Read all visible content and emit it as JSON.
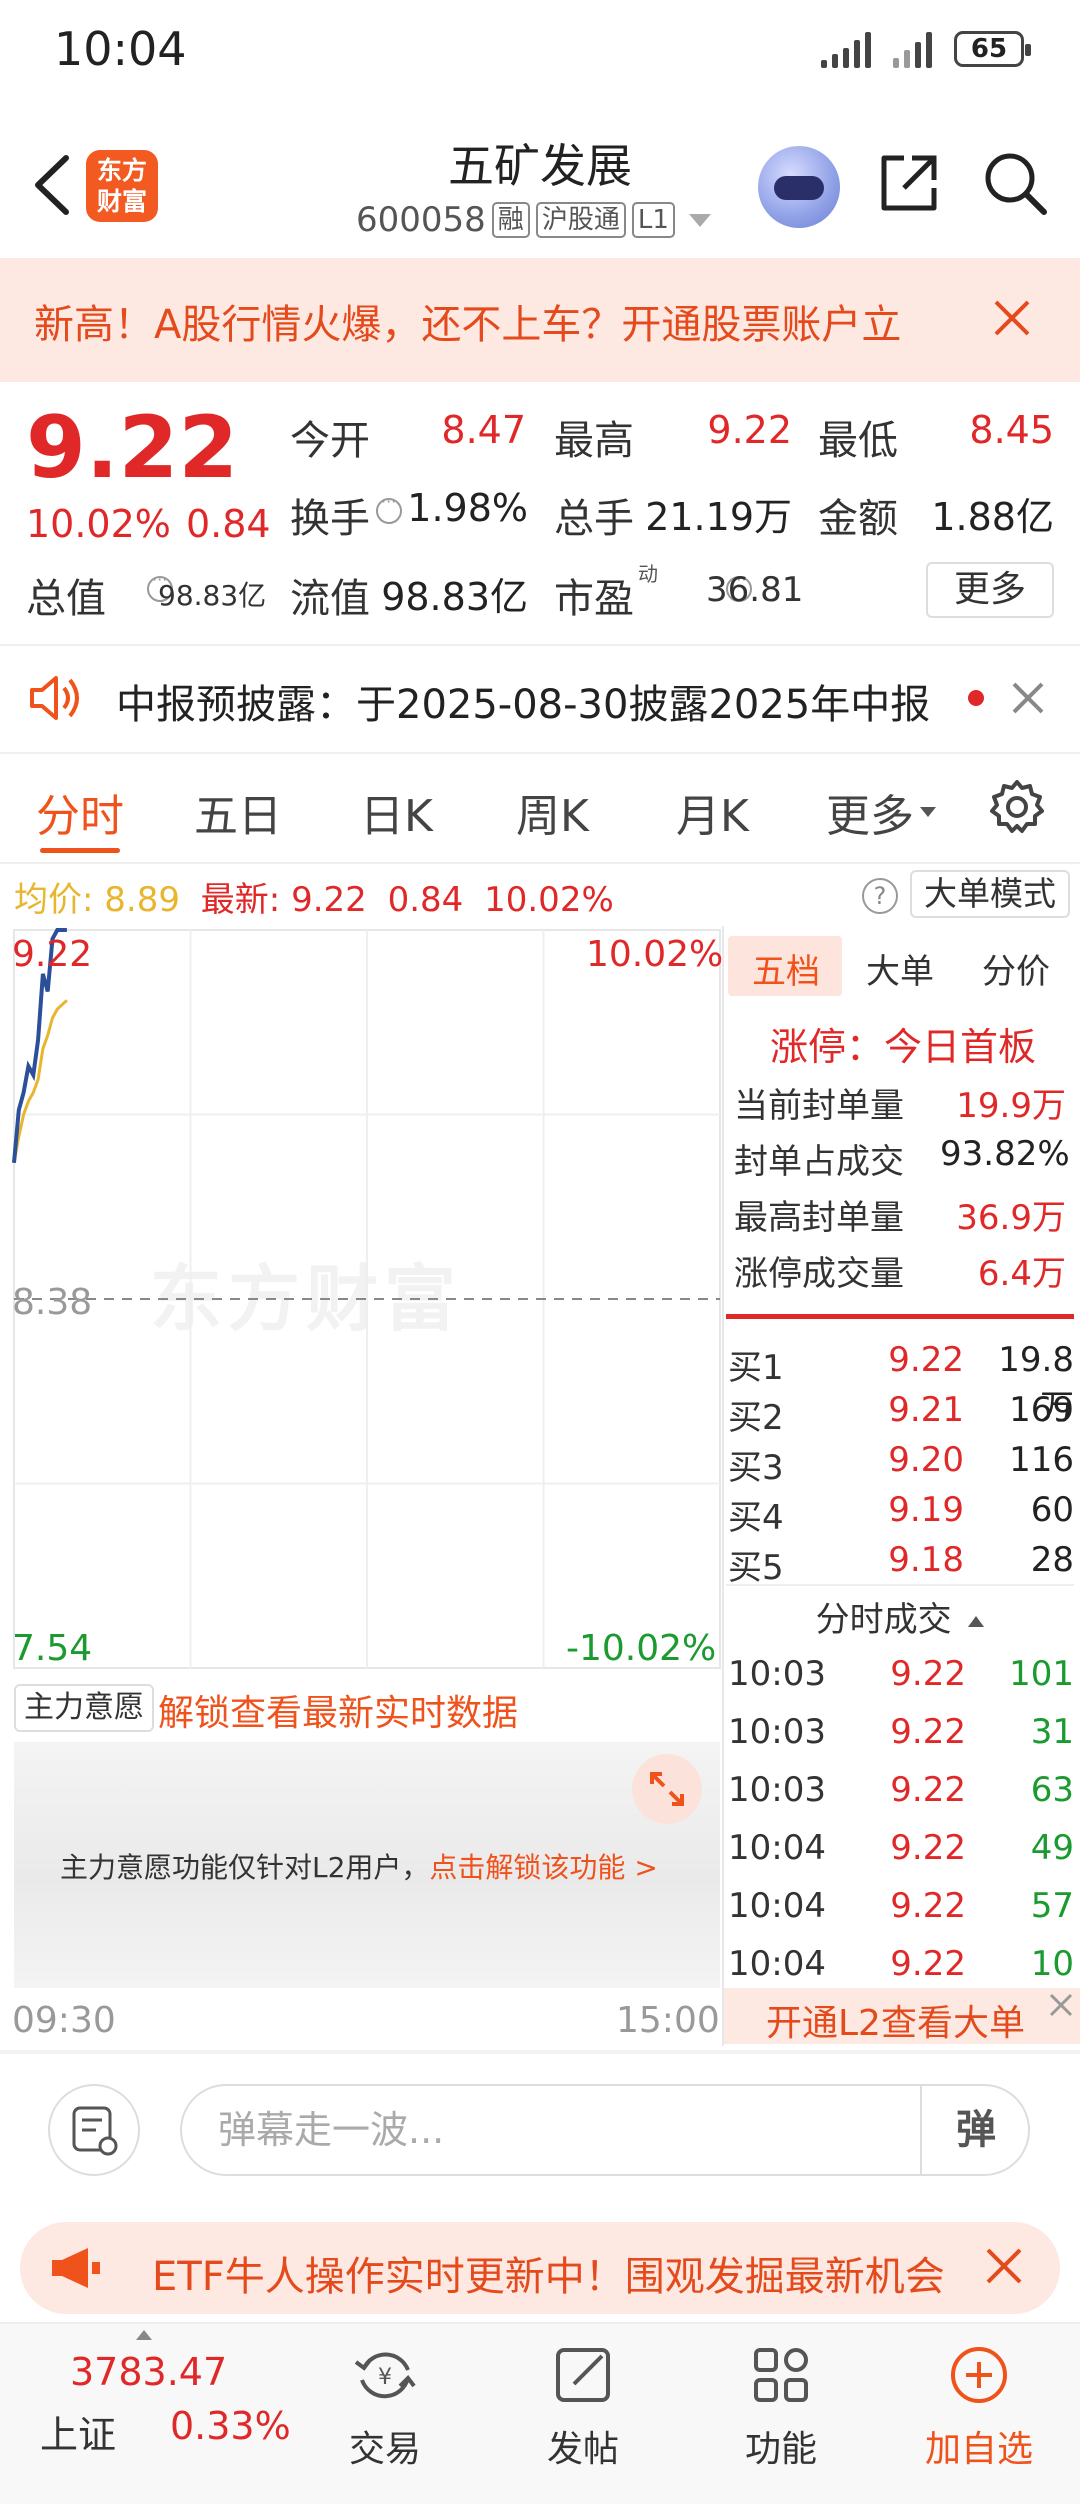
{
  "status_bar": {
    "time": "10:04",
    "battery": "65"
  },
  "header": {
    "logo_text": "东方财富",
    "stock_name": "五矿发展",
    "stock_code": "600058",
    "tags": [
      "融",
      "沪股通",
      "L1"
    ]
  },
  "promo": {
    "text": "新高！A股行情火爆，还不上车？开通股票账户立"
  },
  "quote": {
    "price": "9.22",
    "change_pct": "10.02%",
    "change": "0.84",
    "fields": {
      "open_label": "今开",
      "open": "8.47",
      "high_label": "最高",
      "high": "9.22",
      "low_label": "最低",
      "low": "8.45",
      "turnover_label": "换手",
      "turnover": "1.98%",
      "volume_label": "总手",
      "volume": "21.19万",
      "amount_label": "金额",
      "amount": "1.88亿",
      "mktcap_label": "总值",
      "mktcap": "98.83亿",
      "float_label": "流值",
      "float": "98.83亿",
      "pe_label": "市盈",
      "pe_sup": "动",
      "pe": "36.81"
    },
    "more_label": "更多"
  },
  "notice": {
    "text": "中报预披露：于2025-08-30披露2025年中报"
  },
  "tabs": [
    "分时",
    "五日",
    "日K",
    "周K",
    "月K",
    "更多"
  ],
  "avg_row": {
    "avg_label": "均价:",
    "avg": "8.89",
    "latest_label": "最新:",
    "latest": "9.22",
    "change": "0.84",
    "pct": "10.02%",
    "help": "?",
    "bigorder_label": "大单模式"
  },
  "chart": {
    "hi_price": "9.22",
    "hi_pct": "10.02%",
    "mid_price": "8.38",
    "lo_price": "7.54",
    "lo_pct": "-10.02%",
    "watermark": "东方财富",
    "time_start": "09:30",
    "time_end": "15:00"
  },
  "chart_data": {
    "type": "line",
    "ylim": [
      7.54,
      9.22
    ],
    "prev_close": 8.38,
    "x_range": [
      "09:30",
      "15:00"
    ],
    "series": [
      {
        "values": [
          8.69,
          8.81,
          8.85,
          8.91,
          8.89,
          8.97,
          9.12,
          9.08,
          9.2,
          9.22,
          9.22,
          9.22
        ]
      },
      {
        "values": [
          8.69,
          8.75,
          8.8,
          8.83,
          8.85,
          8.88,
          8.95,
          8.98,
          9.02,
          9.04,
          9.05,
          9.06
        ]
      }
    ],
    "colors": {
      "price": "#2c4f9a",
      "avg": "#e8b52e"
    }
  },
  "main_force": {
    "select_label": "主力意愿",
    "unlock_text": "解锁查看最新实时数据",
    "panel_text": "主力意愿功能仅针对L2用户，",
    "panel_link": "点击解锁该功能 >"
  },
  "right_panel": {
    "tabs": [
      "五档",
      "大单",
      "分价"
    ],
    "limit_text": "涨停：今日首板",
    "stats": [
      {
        "label": "当前封单量",
        "value": "19.9万"
      },
      {
        "label": "封单占成交",
        "value": "93.82%"
      },
      {
        "label": "最高封单量",
        "value": "36.9万"
      },
      {
        "label": "涨停成交量",
        "value": "6.4万"
      }
    ],
    "bids": [
      {
        "label": "买1",
        "price": "9.22",
        "vol": "19.8万"
      },
      {
        "label": "买2",
        "price": "9.21",
        "vol": "169"
      },
      {
        "label": "买3",
        "price": "9.20",
        "vol": "116"
      },
      {
        "label": "买4",
        "price": "9.19",
        "vol": "60"
      },
      {
        "label": "买5",
        "price": "9.18",
        "vol": "28"
      }
    ],
    "ticks_title": "分时成交",
    "ticks": [
      {
        "time": "10:03",
        "price": "9.22",
        "vol": "101"
      },
      {
        "time": "10:03",
        "price": "9.22",
        "vol": "31"
      },
      {
        "time": "10:03",
        "price": "9.22",
        "vol": "63"
      },
      {
        "time": "10:04",
        "price": "9.22",
        "vol": "49"
      },
      {
        "time": "10:04",
        "price": "9.22",
        "vol": "57"
      },
      {
        "time": "10:04",
        "price": "9.22",
        "vol": "10"
      }
    ],
    "l2_banner": "开通L2查看大单"
  },
  "comment": {
    "placeholder": "弹幕走一波...",
    "danmu_label": "弹"
  },
  "etf_banner": {
    "text": "ETF牛人操作实时更新中！围观发掘最新机会"
  },
  "bottom_nav": {
    "index_value": "3783.47",
    "index_name": "上证",
    "index_pct": "0.33%",
    "items": [
      "交易",
      "发帖",
      "功能",
      "加自选"
    ]
  },
  "colors": {
    "up": "#e02828",
    "down": "#1a9a2f",
    "accent": "#f0521c"
  }
}
